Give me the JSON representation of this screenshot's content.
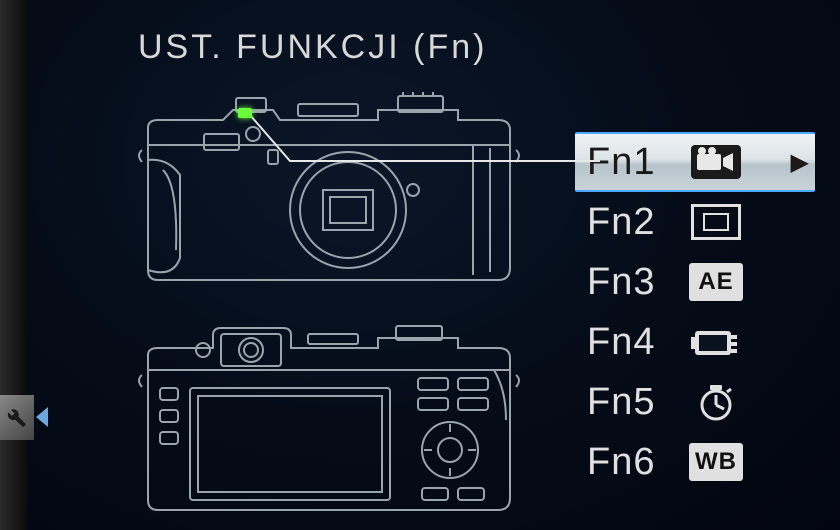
{
  "title": "UST. FUNKCJI (Fn)",
  "selected_index": 0,
  "fn_buttons": [
    {
      "label": "Fn1",
      "icon": "movie",
      "selected": true
    },
    {
      "label": "Fn2",
      "icon": "multi-focus",
      "selected": false
    },
    {
      "label": "Fn3",
      "icon": "AE",
      "selected": false
    },
    {
      "label": "Fn4",
      "icon": "film-sim",
      "selected": false
    },
    {
      "label": "Fn5",
      "icon": "self-timer",
      "selected": false
    },
    {
      "label": "Fn6",
      "icon": "WB",
      "selected": false
    }
  ],
  "highlight_color": "#6aff3a",
  "selection_border": "#4aa8ff"
}
